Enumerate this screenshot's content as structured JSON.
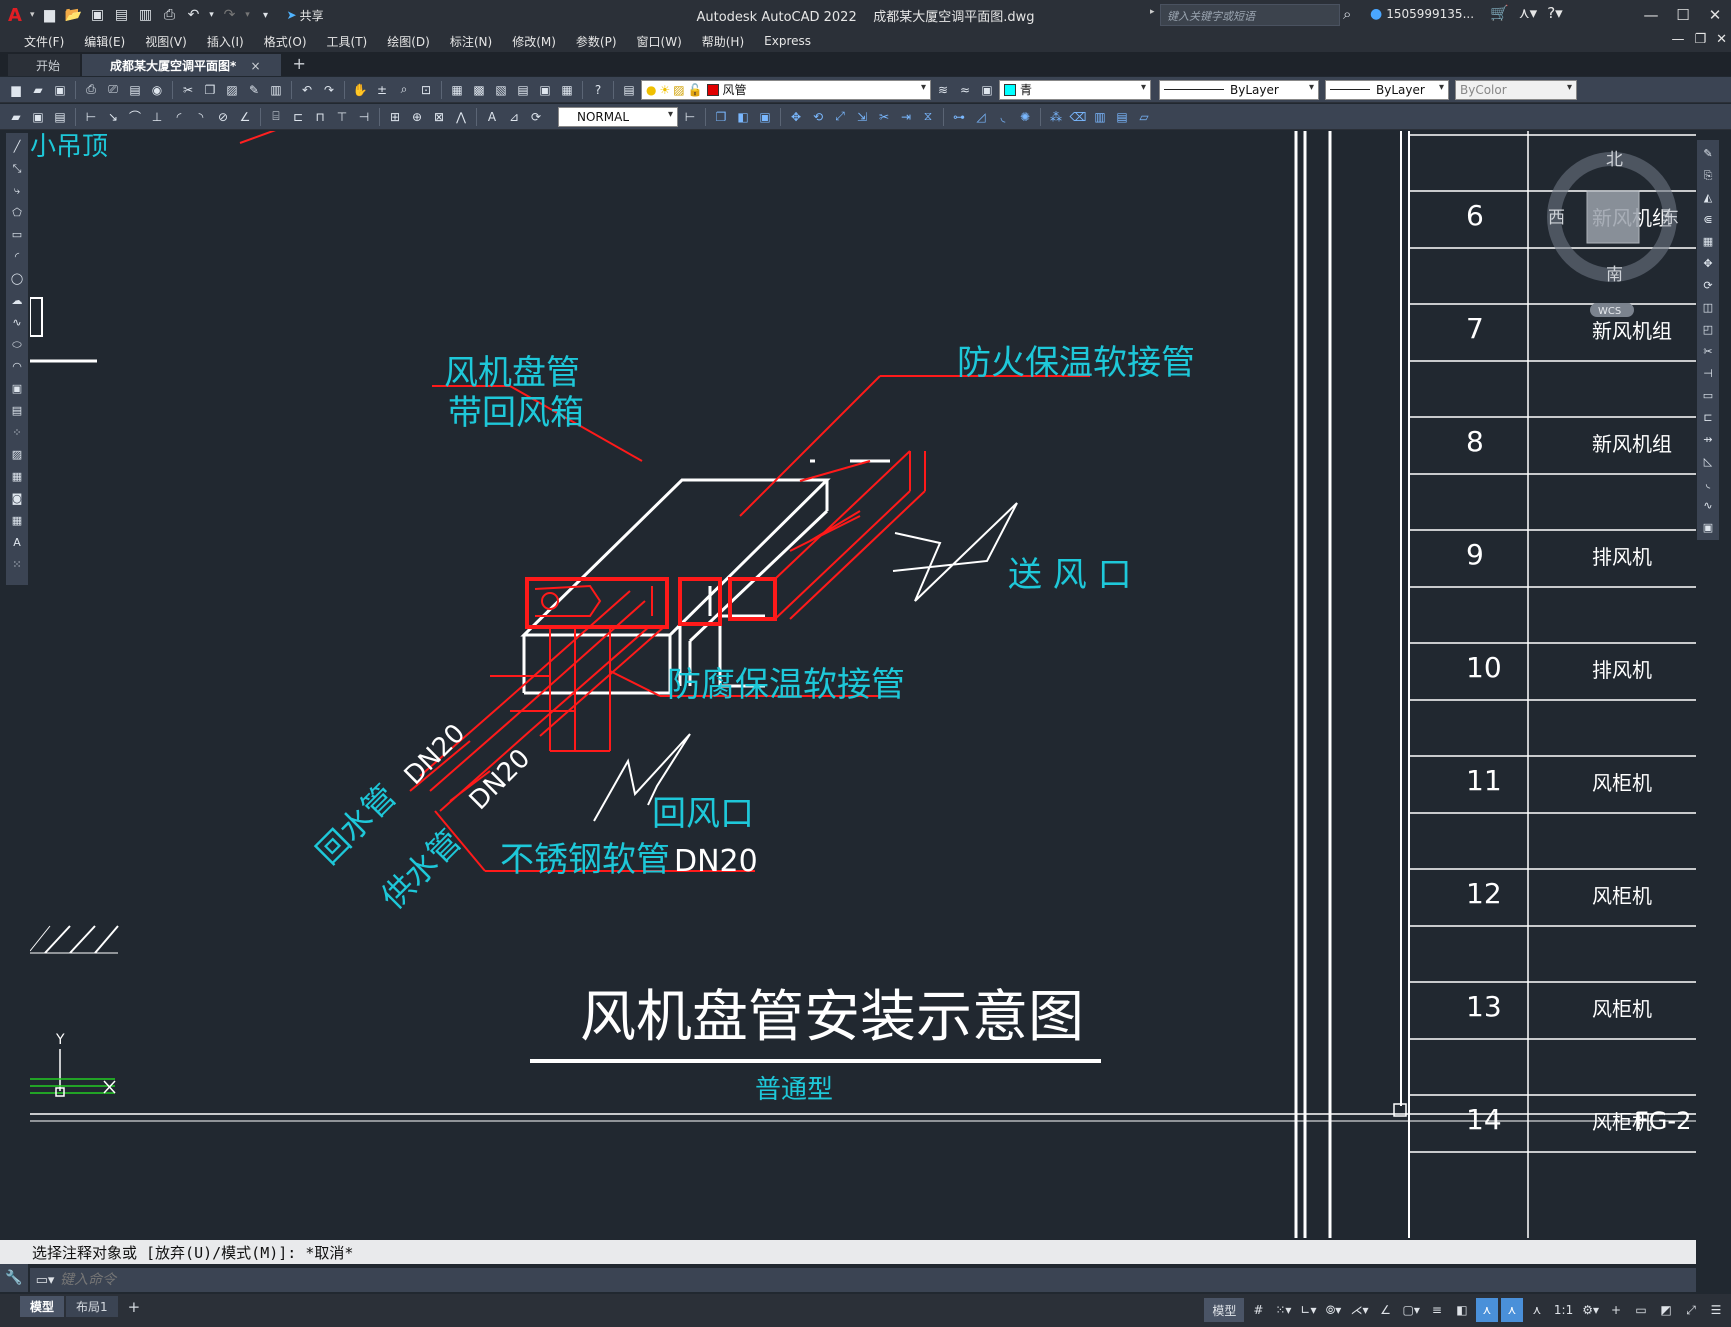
{
  "titlebar": {
    "logo": "A",
    "share_label": "共享",
    "app_name": "Autodesk AutoCAD 2022",
    "file_name": "成都某大厦空调平面图.dwg",
    "search_placeholder": "键入关键字或短语",
    "user_name": "1505999135...",
    "icons": [
      "new-icon",
      "open-icon",
      "save-icon",
      "saveas-icon",
      "publish-icon",
      "print-icon",
      "undo-icon",
      "redo-icon",
      "workspace-dropdown-icon",
      "share-icon"
    ]
  },
  "menubar": {
    "items": [
      "文件(F)",
      "编辑(E)",
      "视图(V)",
      "插入(I)",
      "格式(O)",
      "工具(T)",
      "绘图(D)",
      "标注(N)",
      "修改(M)",
      "参数(P)",
      "窗口(W)",
      "帮助(H)",
      "Express"
    ]
  },
  "tabs": {
    "start": "开始",
    "active": "成都某大厦空调平面图*",
    "close": "×",
    "add": "+"
  },
  "toolbar1": {
    "layer_name": "风管",
    "layer_color": "#e00000",
    "color_name": "青",
    "color_swatch": "#00ffff",
    "linetype": "ByLayer",
    "lineweight": "ByLayer",
    "plotstyle": "ByColor"
  },
  "toolbar2": {
    "dimstyle": "NORMAL"
  },
  "drawing": {
    "label_fan_coil": "风机盘管",
    "label_return_box": "带回风箱",
    "label_fire_joint": "防火保温软接管",
    "label_supply_outlet": "送 风 口",
    "label_anticorrosion_joint": "防腐保温软接管",
    "label_return_outlet": "回风口",
    "label_return_pipe": "回水管",
    "label_supply_pipe": "供水管",
    "label_dn20_a": "DN20",
    "label_dn20_b": "DN20",
    "label_steel_hose": "不锈钢软管",
    "label_dn20_c": "DN20",
    "title": "风机盘管安装示意图",
    "subtitle": "普通型",
    "ucs_y": "Y",
    "top_left_fragment": "小吊顶",
    "colors": {
      "cyan": "#1ec8d9",
      "red": "#ff1a1a",
      "white": "#ffffff",
      "background": "#212830"
    }
  },
  "table": {
    "rows": [
      {
        "no": "6",
        "name": "新风机组",
        "code": ""
      },
      {
        "no": "7",
        "name": "新风机组",
        "code": ""
      },
      {
        "no": "8",
        "name": "新风机组",
        "code": ""
      },
      {
        "no": "9",
        "name": "排风机",
        "code": ""
      },
      {
        "no": "10",
        "name": "排风机",
        "code": ""
      },
      {
        "no": "11",
        "name": "风柜机",
        "code": ""
      },
      {
        "no": "12",
        "name": "风柜机",
        "code": ""
      },
      {
        "no": "13",
        "name": "风柜机",
        "code": ""
      },
      {
        "no": "14",
        "name": "风柜机",
        "code": "FG-2"
      }
    ]
  },
  "viewcube": {
    "north": "北",
    "south": "南",
    "east": "东",
    "west": "西",
    "ucs": "WCS"
  },
  "command": {
    "history": "选择注释对象或 [放弃(U)/模式(M)]: *取消*",
    "placeholder": "键入命令"
  },
  "statusbar": {
    "layout_tabs": [
      "模型",
      "布局1"
    ],
    "add": "+",
    "model_label": "模型",
    "scale": "1:1"
  }
}
